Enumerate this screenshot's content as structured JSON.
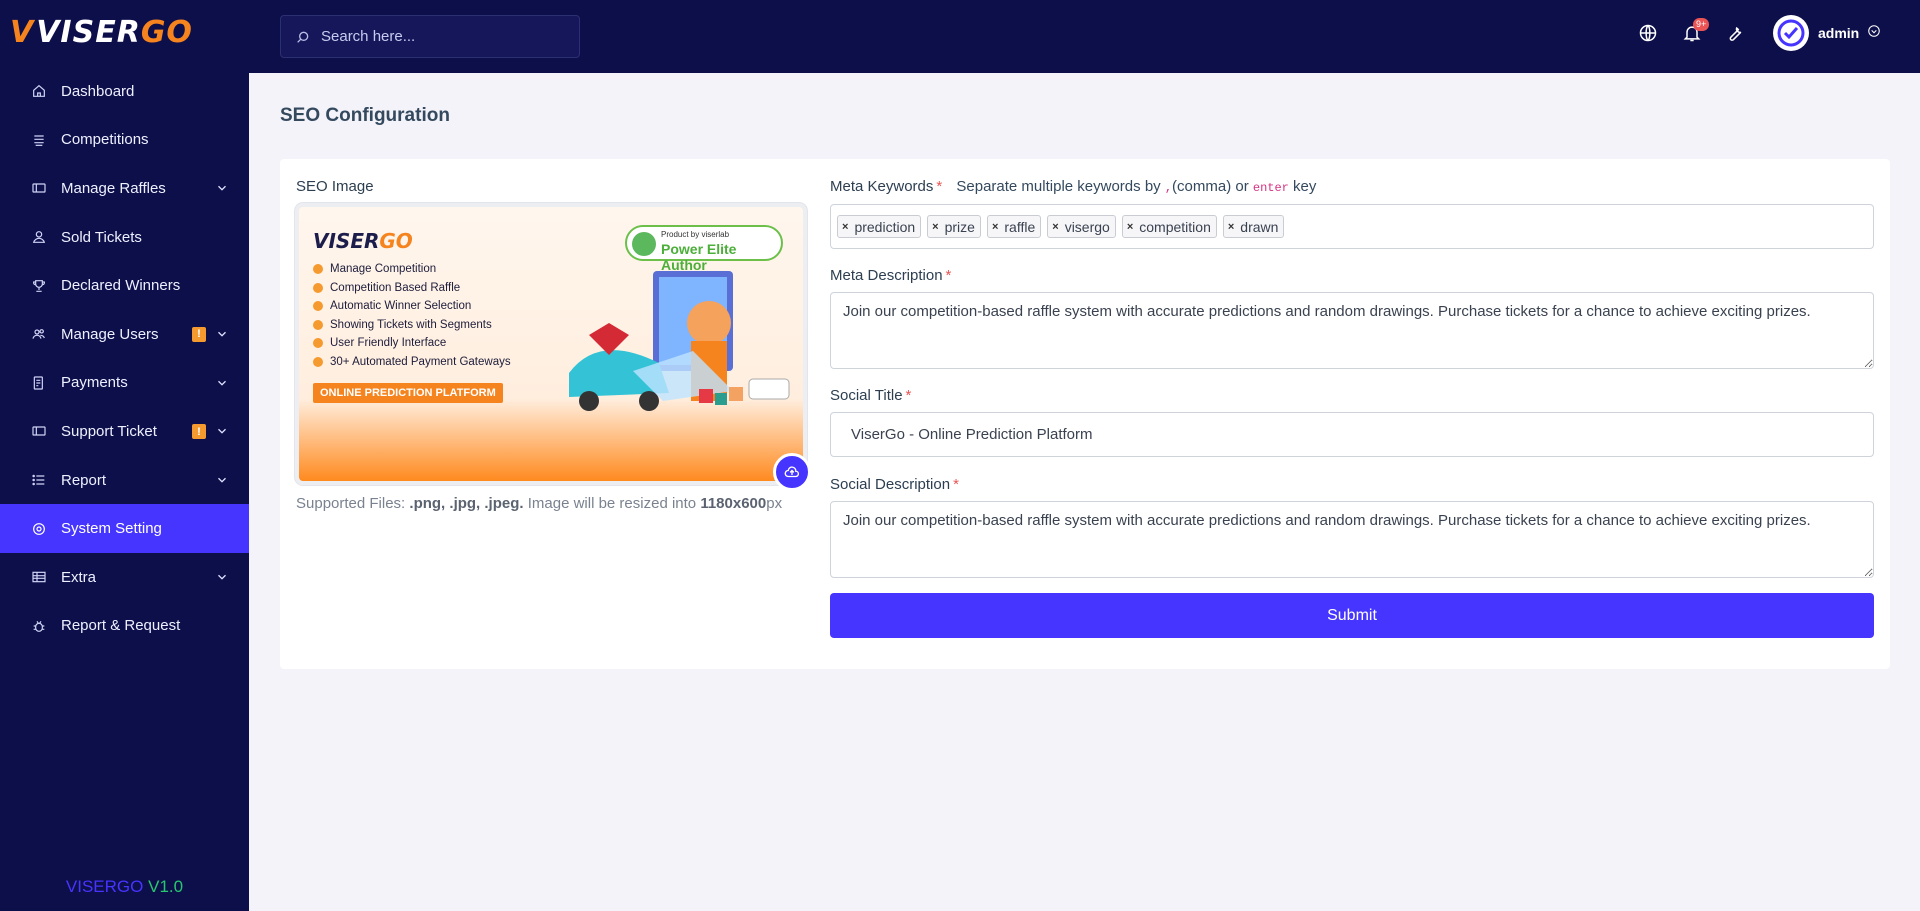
{
  "brand": {
    "name": "VISERGO",
    "version_name": "VISERGO",
    "version_num": "V1.0"
  },
  "search": {
    "placeholder": "Search here..."
  },
  "header": {
    "notification_count": "9+",
    "user_name": "admin"
  },
  "sidebar": {
    "items": [
      {
        "label": "Dashboard",
        "icon": "home-icon"
      },
      {
        "label": "Competitions",
        "icon": "stack-icon"
      },
      {
        "label": "Manage Raffles",
        "icon": "ticket-icon"
      },
      {
        "label": "Sold Tickets",
        "icon": "user-icon"
      },
      {
        "label": "Declared Winners",
        "icon": "trophy-icon"
      },
      {
        "label": "Manage Users",
        "icon": "users-icon",
        "badge": "!"
      },
      {
        "label": "Payments",
        "icon": "payment-icon"
      },
      {
        "label": "Support Ticket",
        "icon": "ticket-icon",
        "badge": "!"
      },
      {
        "label": "Report",
        "icon": "list-icon"
      },
      {
        "label": "System Setting",
        "icon": "settings-icon",
        "active": true
      },
      {
        "label": "Extra",
        "icon": "table-icon"
      },
      {
        "label": "Report & Request",
        "icon": "bug-icon"
      }
    ]
  },
  "page": {
    "title": "SEO Configuration"
  },
  "form": {
    "seo_image_label": "SEO Image",
    "supported_prefix": "Supported Files: ",
    "supported_types": ".png, .jpg, .jpeg.",
    "resize_text": " Image will be resized into ",
    "resize_size": "1180x600",
    "resize_unit": "px",
    "meta_keywords_label": "Meta Keywords",
    "keywords_hint_pre": "Separate multiple keywords by ",
    "keywords_hint_comma": ",",
    "keywords_hint_mid": "(comma) or ",
    "keywords_hint_enter": "enter",
    "keywords_hint_post": " key",
    "keywords": [
      "prediction",
      "prize",
      "raffle",
      "visergo",
      "competition",
      "drawn"
    ],
    "meta_description_label": "Meta Description",
    "meta_description": "Join our competition-based raffle system with accurate predictions and random drawings. Purchase tickets for a chance to achieve exciting prizes.",
    "social_title_label": "Social Title",
    "social_title": "ViserGo - Online Prediction Platform",
    "social_description_label": "Social Description",
    "social_description": "Join our competition-based raffle system with accurate predictions and random drawings. Purchase tickets for a chance to achieve exciting prizes.",
    "required_mark": "*",
    "submit_label": "Submit"
  },
  "banner": {
    "logo": "VISERGO",
    "features": [
      "Manage Competition",
      "Competition Based Raffle",
      "Automatic Winner Selection",
      "Showing Tickets with Segments",
      "User Friendly Interface",
      "30+ Automated Payment Gateways"
    ],
    "cta": "ONLINE PREDICTION PLATFORM",
    "badge_small": "Product by viserlab",
    "badge_big": "Power Elite Author"
  },
  "colors": {
    "sidebar": "#0d0f4a",
    "accent": "#4634ff",
    "orange": "#f5841f",
    "green": "#28c76f"
  }
}
